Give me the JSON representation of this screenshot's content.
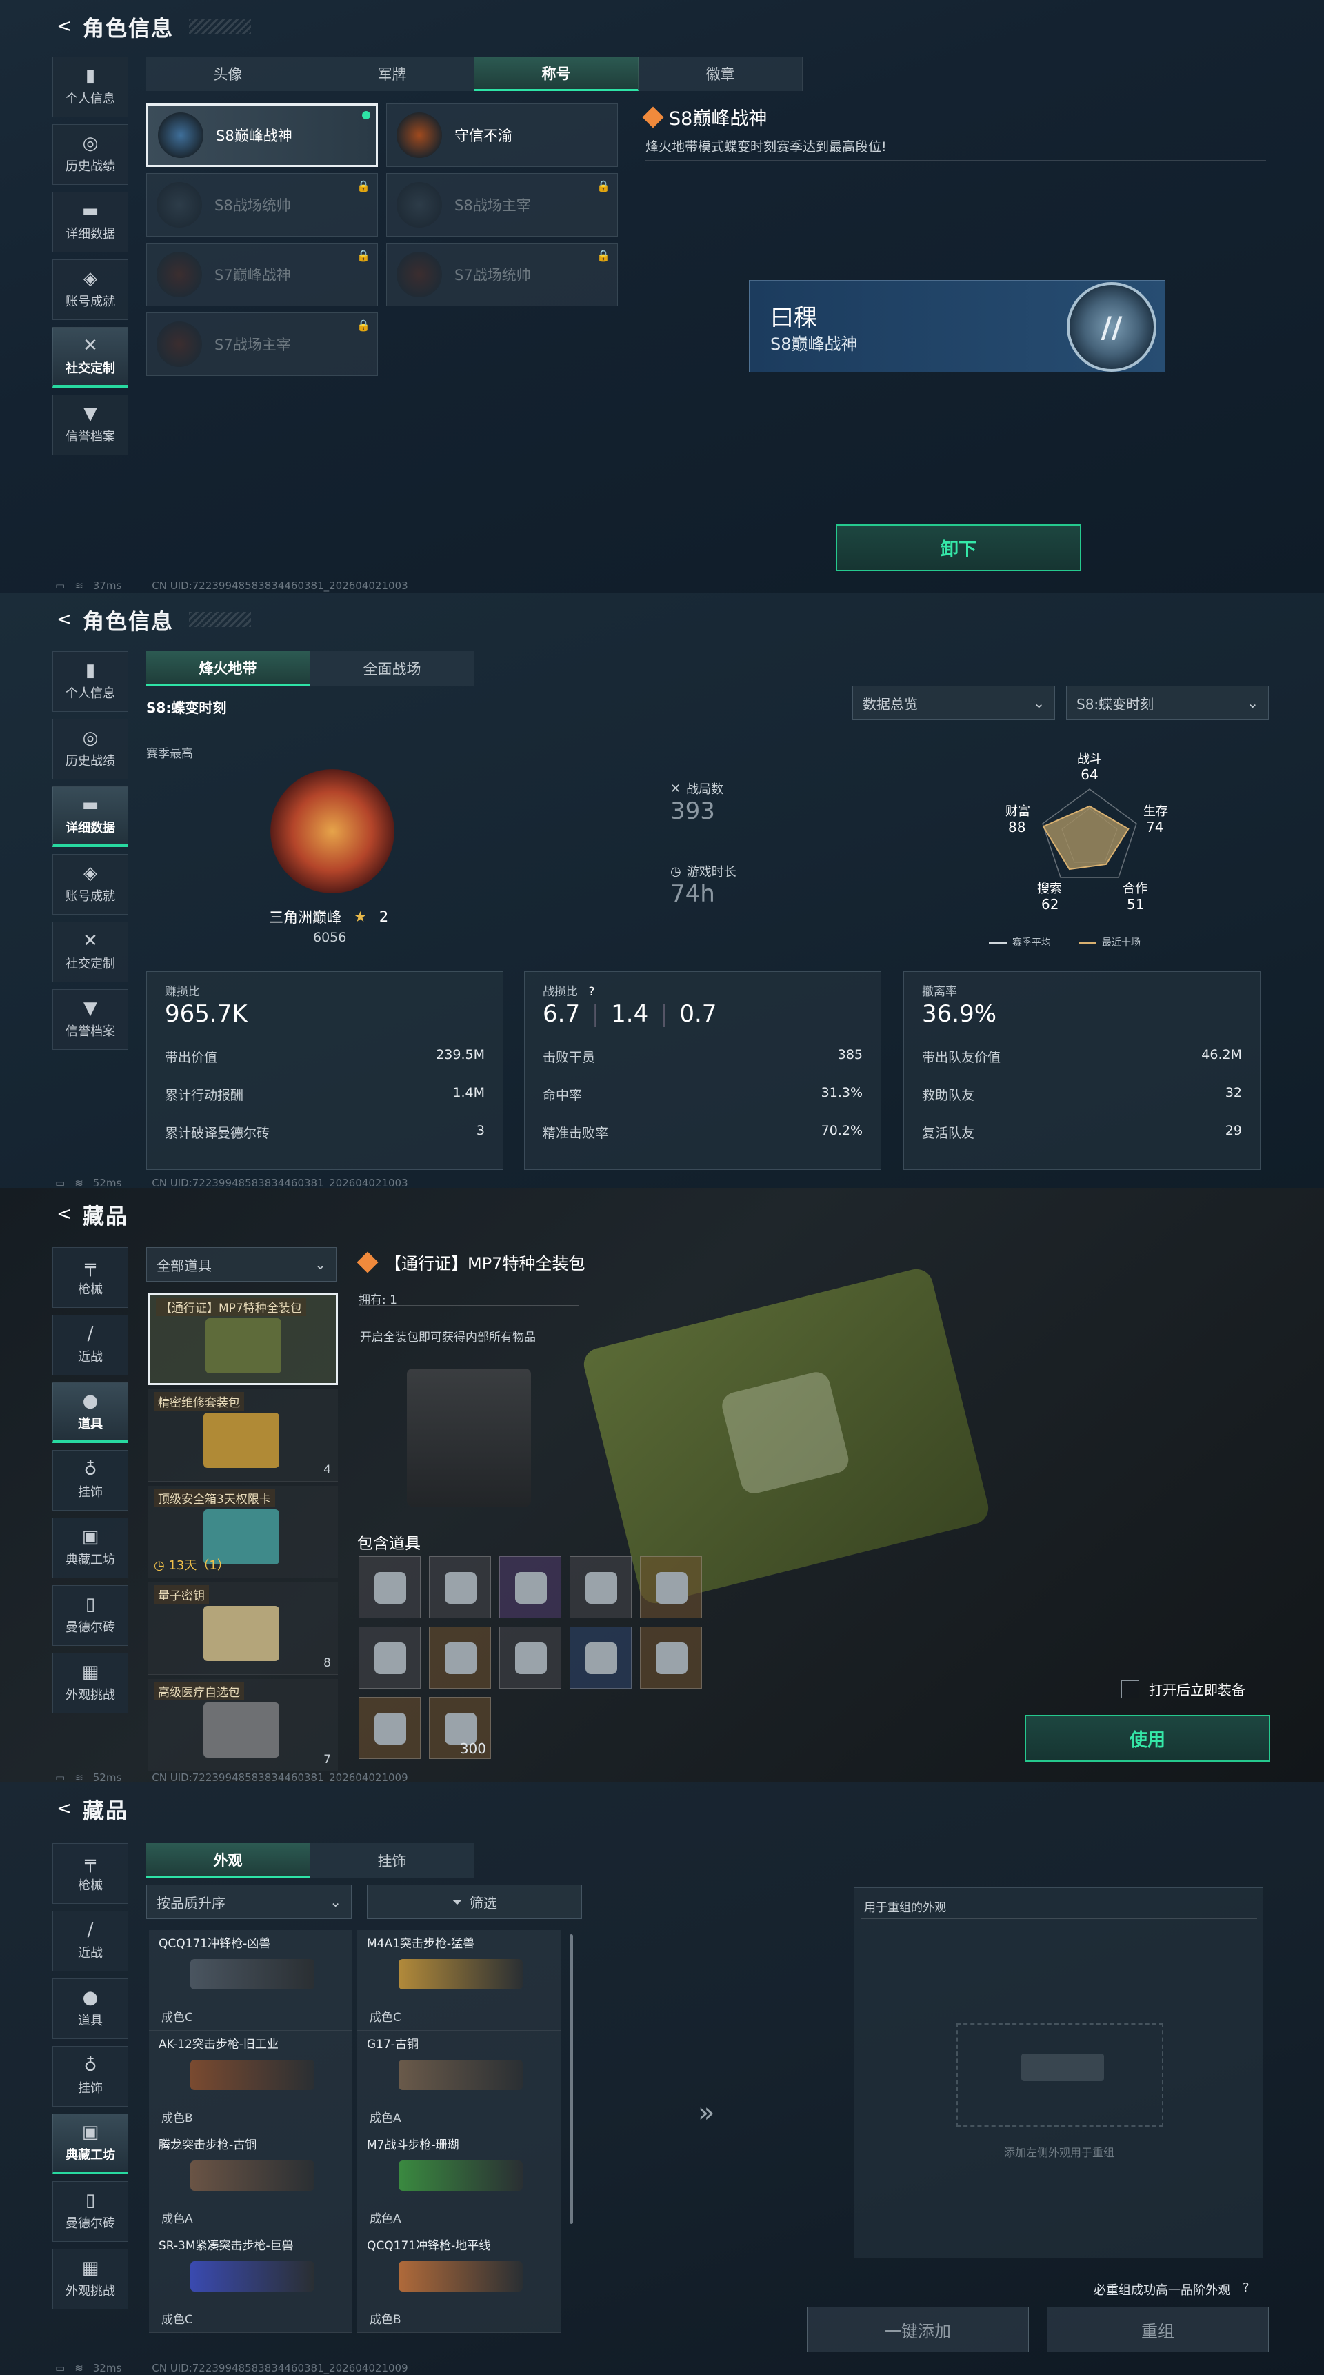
{
  "screen1": {
    "title": "角色信息",
    "back": "<",
    "sidebar": [
      {
        "label": "个人信息",
        "icon": "bar-chart-icon",
        "glyph": "▮",
        "active": false
      },
      {
        "label": "历史战绩",
        "icon": "history-icon",
        "glyph": "◎",
        "active": false
      },
      {
        "label": "详细数据",
        "icon": "folder-icon",
        "glyph": "▬",
        "active": false
      },
      {
        "label": "账号成就",
        "icon": "achievement-icon",
        "glyph": "◈",
        "active": false
      },
      {
        "label": "社交定制",
        "icon": "tools-icon",
        "glyph": "✕",
        "active": true
      },
      {
        "label": "信誉档案",
        "icon": "shield-icon",
        "glyph": "▼",
        "active": false
      }
    ],
    "tabs": [
      "头像",
      "军牌",
      "称号",
      "徽章"
    ],
    "active_tab": "称号",
    "titles": [
      {
        "name": "S8巅峰战神",
        "locked": false,
        "selected": true,
        "color": "#3f6f9a"
      },
      {
        "name": "守信不渝",
        "locked": false,
        "selected": false,
        "color": "#a04a1e"
      },
      {
        "name": "S8战场统帅",
        "locked": true,
        "selected": false,
        "color": "#3a4a55"
      },
      {
        "name": "S8战场主宰",
        "locked": true,
        "selected": false,
        "color": "#3a4a55"
      },
      {
        "name": "S7巅峰战神",
        "locked": true,
        "selected": false,
        "color": "#5a2a1e"
      },
      {
        "name": "S7战场统帅",
        "locked": true,
        "selected": false,
        "color": "#5a2a1e"
      },
      {
        "name": "S7战场主宰",
        "locked": true,
        "selected": false,
        "color": "#5a2a1e"
      }
    ],
    "detail_title": "S8巅峰战神",
    "detail_desc": "烽火地带模式蝶变时刻赛季达到最高段位!",
    "preview_name": "曰稞",
    "preview_title": "S8巅峰战神",
    "unequip_button": "卸下",
    "footer_ping": "37ms",
    "footer_uid": "CN UID:72239948583834460381_202604021003"
  },
  "screen2": {
    "title": "角色信息",
    "sidebar_active": "详细数据",
    "tabs": [
      "烽火地带",
      "全面战场"
    ],
    "active_tab": "烽火地带",
    "season_label": "S8:蝶变时刻",
    "dropdown_left": "数据总览",
    "dropdown_right": "S8:蝶变时刻",
    "season_best": "赛季最高",
    "rank_name": "三角洲巅峰",
    "rank_stars": "2",
    "rank_score": "6056",
    "matches_label": "战局数",
    "matches_value": "393",
    "playtime_label": "游戏时长",
    "playtime_value": "74h",
    "radar": {
      "battle": {
        "label": "战斗",
        "value": "64"
      },
      "survive": {
        "label": "生存",
        "value": "74"
      },
      "cooperate": {
        "label": "合作",
        "value": "51"
      },
      "search": {
        "label": "搜索",
        "value": "62"
      },
      "wealth": {
        "label": "财富",
        "value": "88"
      },
      "legend_avg": "赛季平均",
      "legend_recent": "最近十场"
    },
    "box1": {
      "label": "赚损比",
      "big": "965.7K",
      "rows": [
        [
          "带出价值",
          "239.5M"
        ],
        [
          "累计行动报酬",
          "1.4M"
        ],
        [
          "累计破译曼德尔砖",
          "3"
        ]
      ]
    },
    "box2": {
      "label": "战损比",
      "help": "?",
      "big1": "6.7",
      "big2": "1.4",
      "big3": "0.7",
      "rows": [
        [
          "击败干员",
          "385"
        ],
        [
          "命中率",
          "31.3%"
        ],
        [
          "精准击败率",
          "70.2%"
        ]
      ]
    },
    "box3": {
      "label": "撤离率",
      "big": "36.9%",
      "rows": [
        [
          "带出队友价值",
          "46.2M"
        ],
        [
          "救助队友",
          "32"
        ],
        [
          "复活队友",
          "29"
        ]
      ]
    },
    "footer_ping": "52ms",
    "footer_uid": "CN UID:72239948583834460381_202604021003"
  },
  "screen3": {
    "title": "藏品",
    "sidebar": [
      {
        "label": "枪械",
        "icon": "gun-icon",
        "glyph": "╤"
      },
      {
        "label": "近战",
        "icon": "knife-icon",
        "glyph": "/"
      },
      {
        "label": "道具",
        "icon": "items-icon",
        "glyph": "●"
      },
      {
        "label": "挂饰",
        "icon": "charm-icon",
        "glyph": "♁"
      },
      {
        "label": "典藏工坊",
        "icon": "workshop-icon",
        "glyph": "▣"
      },
      {
        "label": "曼德尔砖",
        "icon": "brick-icon",
        "glyph": "▯"
      },
      {
        "label": "外观挑战",
        "icon": "challenge-icon",
        "glyph": "▦"
      }
    ],
    "sidebar_active": "道具",
    "filter": "全部道具",
    "items": [
      {
        "name": "【通行证】MP7特种全装包",
        "count": "",
        "color": "#5e6b3a",
        "selected": true
      },
      {
        "name": "精密维修套装包",
        "count": "4",
        "color": "#b08a36",
        "selected": false
      },
      {
        "name": "顶级安全箱3天权限卡",
        "count": "",
        "timer": "13天（1）",
        "color": "#3f8a8a",
        "selected": false
      },
      {
        "name": "量子密钥",
        "count": "8",
        "color": "#b4a57a",
        "selected": false
      },
      {
        "name": "高级医疗自选包",
        "count": "7",
        "color": "#6e7073",
        "selected": false
      }
    ],
    "detail_title": "【通行证】MP7特种全装包",
    "own_label": "拥有: 1",
    "desc": "开启全装包即可获得内部所有物品",
    "contains_label": "包含道具",
    "slots": [
      {
        "rarity": "",
        "tag": ""
      },
      {
        "rarity": "",
        "tag": ""
      },
      {
        "rarity": "purple",
        "tag": ""
      },
      {
        "rarity": "",
        "tag": ""
      },
      {
        "rarity": "gold",
        "tag": ""
      },
      {
        "rarity": "",
        "tag": ""
      },
      {
        "rarity": "gold",
        "tag": ""
      },
      {
        "rarity": "",
        "tag": ""
      },
      {
        "rarity": "blue",
        "tag": ""
      },
      {
        "rarity": "gold",
        "tag": ""
      },
      {
        "rarity": "gold",
        "tag": ""
      },
      {
        "rarity": "gold",
        "tag": "300"
      }
    ],
    "auto_equip": "打开后立即装备",
    "use_button": "使用",
    "footer_ping": "52ms",
    "footer_uid": "CN UID:72239948583834460381_202604021009"
  },
  "screen4": {
    "title": "藏品",
    "sidebar_active": "典藏工坊",
    "tabs": [
      "外观",
      "挂饰"
    ],
    "active_tab": "外观",
    "sort": "按品质升序",
    "filter_button": "筛选",
    "weapons": [
      {
        "name": "QCQ171冲锋枪-凶兽",
        "quality": "成色C",
        "color": "#4a5560"
      },
      {
        "name": "M4A1突击步枪-猛兽",
        "quality": "成色C",
        "color": "#b28a3a"
      },
      {
        "name": "AK-12突击步枪-旧工业",
        "quality": "成色B",
        "color": "#7a4a30"
      },
      {
        "name": "G17-古铜",
        "quality": "成色A",
        "color": "#6a5a4a"
      },
      {
        "name": "腾龙突击步枪-古铜",
        "quality": "成色A",
        "color": "#6a5445"
      },
      {
        "name": "M7战斗步枪-珊瑚",
        "quality": "成色A",
        "color": "#3a8a40"
      },
      {
        "name": "SR-3M紧凑突击步枪-巨兽",
        "quality": "成色C",
        "color": "#3a4ab0"
      },
      {
        "name": "QCQ171冲锋枪-地平线",
        "quality": "成色B",
        "color": "#b06a3a"
      }
    ],
    "panel_title": "用于重组的外观",
    "panel_hint": "添加左侧外观用于重组",
    "note": "必重组成功高一品阶外观",
    "note_help": "?",
    "btn_add": "一键添加",
    "btn_recombine": "重组",
    "footer_ping": "32ms",
    "footer_uid": "CN UID:72239948583834460381_202604021009"
  }
}
